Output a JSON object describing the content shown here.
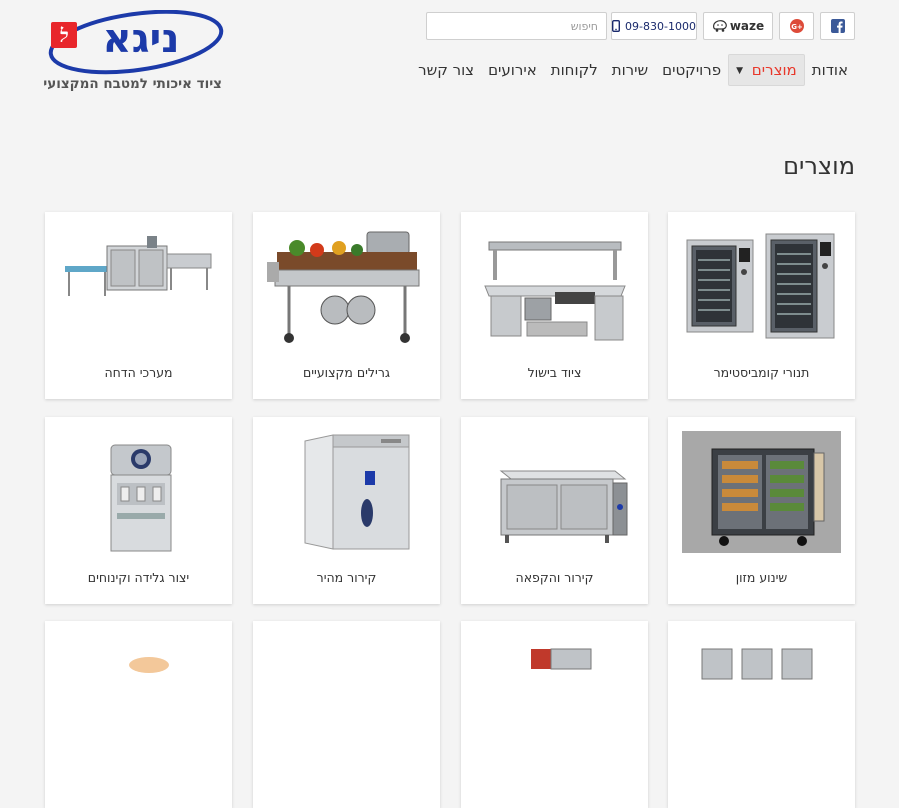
{
  "brand": {
    "logo_text": "ניגא",
    "logo_mark": "ל",
    "tagline": "ציוד איכותי למטבח המקצועי",
    "colors": {
      "blue": "#1c3aa9",
      "red": "#e8262b"
    }
  },
  "topbar": {
    "search_placeholder": "חיפוש",
    "phone": "09-830-1000",
    "waze_label": "waze",
    "gplus_label": "G+",
    "facebook_label": "f"
  },
  "nav": {
    "items": [
      {
        "label": "אודות"
      },
      {
        "label": "מוצרים",
        "active": true,
        "has_dropdown": true
      },
      {
        "label": "פרויקטים"
      },
      {
        "label": "שירות"
      },
      {
        "label": "לקוחות"
      },
      {
        "label": "אירועים"
      },
      {
        "label": "צור קשר"
      }
    ]
  },
  "page": {
    "title": "מוצרים"
  },
  "products": [
    {
      "label": "תנורי קומביסטימר",
      "icon": "combi-oven-icon"
    },
    {
      "label": "ציוד בישול",
      "icon": "cooking-station-icon"
    },
    {
      "label": "גרילים מקצועיים",
      "icon": "grill-icon"
    },
    {
      "label": "מערכי הדחה",
      "icon": "dishwasher-line-icon"
    },
    {
      "label": "שינוע מזון",
      "icon": "food-cart-icon"
    },
    {
      "label": "קירור והקפאה",
      "icon": "refrigerated-counter-icon"
    },
    {
      "label": "קירור מהיר",
      "icon": "blast-chiller-icon"
    },
    {
      "label": "יצור גלידה וקינוחים",
      "icon": "ice-cream-machine-icon"
    },
    {
      "label": "",
      "icon": "product-icon"
    },
    {
      "label": "",
      "icon": "product-icon"
    },
    {
      "label": "",
      "icon": "product-icon"
    },
    {
      "label": "",
      "icon": "product-icon"
    }
  ]
}
